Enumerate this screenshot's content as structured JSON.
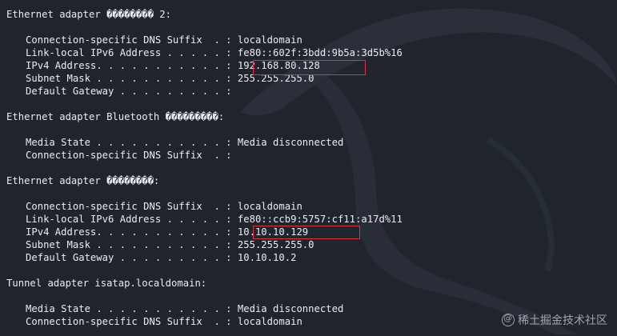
{
  "terminal": {
    "background": "#1f242d",
    "text_color": "#eaeef2",
    "highlight_color": "#d9343f",
    "blocks": [
      {
        "header": "Ethernet adapter �������� 2:",
        "entries": [
          {
            "label": "Connection-specific DNS Suffix  . : ",
            "value": "localdomain"
          },
          {
            "label": "Link-local IPv6 Address . . . . . : ",
            "value": "fe80::602f:3bdd:9b5a:3d5b%16"
          },
          {
            "label": "IPv4 Address. . . . . . . . . . . : ",
            "value": "192.168.80.128"
          },
          {
            "label": "Subnet Mask . . . . . . . . . . . : ",
            "value": "255.255.255.0"
          },
          {
            "label": "Default Gateway . . . . . . . . . : ",
            "value": ""
          }
        ]
      },
      {
        "header": "Ethernet adapter Bluetooth ���������:",
        "entries": [
          {
            "label": "Media State . . . . . . . . . . . : ",
            "value": "Media disconnected"
          },
          {
            "label": "Connection-specific DNS Suffix  . : ",
            "value": ""
          }
        ]
      },
      {
        "header": "Ethernet adapter ��������:",
        "entries": [
          {
            "label": "Connection-specific DNS Suffix  . : ",
            "value": "localdomain"
          },
          {
            "label": "Link-local IPv6 Address . . . . . : ",
            "value": "fe80::ccb9:5757:cf11:a17d%11"
          },
          {
            "label": "IPv4 Address. . . . . . . . . . . : ",
            "value": "10.10.10.129"
          },
          {
            "label": "Subnet Mask . . . . . . . . . . . : ",
            "value": "255.255.255.0"
          },
          {
            "label": "Default Gateway . . . . . . . . . : ",
            "value": "10.10.10.2"
          }
        ]
      },
      {
        "header": "Tunnel adapter isatap.localdomain:",
        "entries": [
          {
            "label": "Media State . . . . . . . . . . . : ",
            "value": "Media disconnected"
          },
          {
            "label": "Connection-specific DNS Suffix  . : ",
            "value": "localdomain"
          }
        ]
      }
    ]
  },
  "watermark": {
    "text": "稀土掘金技术社区",
    "icon": "at-sign-icon"
  }
}
